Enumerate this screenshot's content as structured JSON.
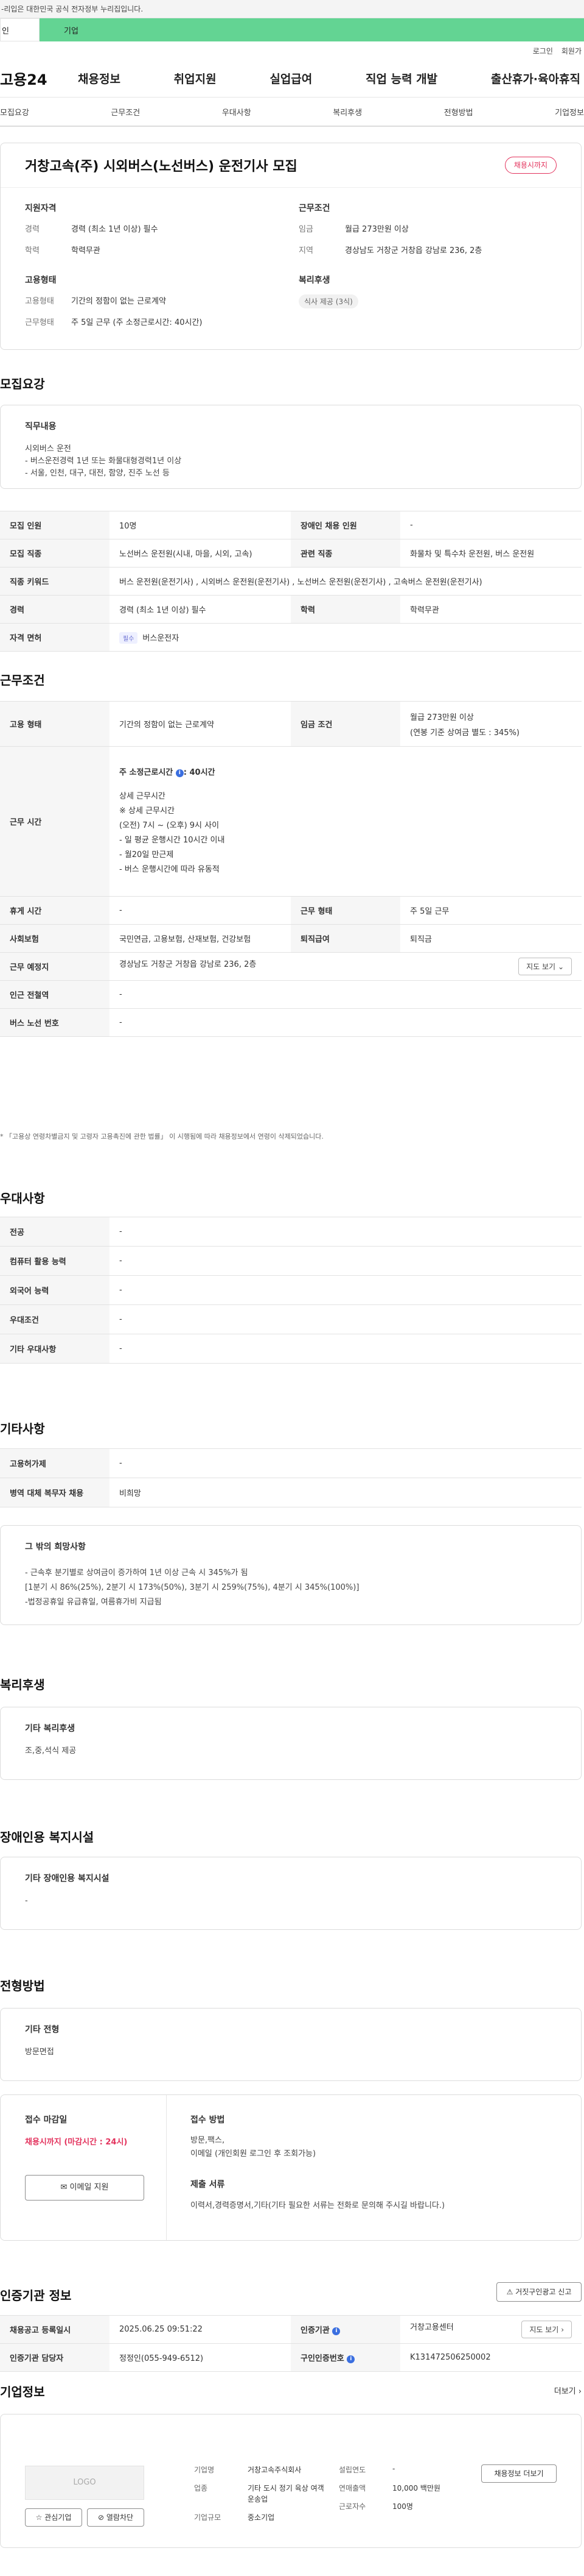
{
  "topbar": {
    "notice": "-리입은 대한민국 공식 전자정부 누리집입니다."
  },
  "target_tabs": {
    "personal": "인",
    "company": "기업"
  },
  "util_links": [
    "로그인",
    "회원가"
  ],
  "gnb": {
    "logo": "고용24",
    "menu": [
      "채용정보",
      "취업지원",
      "실업급여",
      "직업 능력 개발",
      "출산휴가·육아휴직"
    ]
  },
  "anchor_tabs": [
    "모집요강",
    "근무조건",
    "우대사항",
    "복리후생",
    "전형방법",
    "기업정보"
  ],
  "job": {
    "title": "거창고속(주) 시외버스(노선버스) 운전기사 모집",
    "status_pill": "채용시까지",
    "qualification": {
      "heading": "지원자격",
      "rows": [
        {
          "k": "경력",
          "v": "경력 (최소 1년 이상) 필수"
        },
        {
          "k": "학력",
          "v": "학력무관"
        }
      ]
    },
    "conditions": {
      "heading": "근무조건",
      "rows": [
        {
          "k": "임금",
          "v": "월급 273만원 이상"
        },
        {
          "k": "지역",
          "v": "경상남도 거창군 거창읍 강남로 236, 2층"
        }
      ]
    },
    "employment": {
      "heading": "고용형태",
      "rows": [
        {
          "k": "고용형태",
          "v": "기간의 정함이 없는 근로계약"
        },
        {
          "k": "근무형태",
          "v": "주 5일 근무 (주 소정근로시간: 40시간)"
        }
      ]
    },
    "welfare": {
      "heading": "복리후생",
      "chip": "식사 제공 (3식)"
    }
  },
  "recruit": {
    "section_title": "모집요강",
    "duty_heading": "직무내용",
    "duty_text": "시외버스 운전\n- 버스운전경력 1년 또는 화물대형경력1년 이상\n- 서울, 인천, 대구, 대전, 함양, 진주 노선 등",
    "rows": [
      {
        "k1": "모집 인원",
        "v1": "10명",
        "k2": "장애인 채용 인원",
        "v2": "-"
      },
      {
        "k1": "모집 직종",
        "v1": "노선버스 운전원(시내, 마을, 시외, 고속)",
        "k2": "관련 직종",
        "v2": "화물차 및 특수차 운전원, 버스 운전원"
      },
      {
        "k": "직종 키워드",
        "v": "버스 운전원(운전기사) , 시외버스 운전원(운전기사) , 노선버스 운전원(운전기사) , 고속버스 운전원(운전기사)"
      },
      {
        "k1": "경력",
        "v1": "경력 (최소 1년 이상) 필수",
        "k2": "학력",
        "v2": "학력무관"
      },
      {
        "k": "자격 면허",
        "badge": "필수",
        "v": "버스운전자"
      }
    ]
  },
  "work": {
    "section_title": "근무조건",
    "employment_k": "고용 형태",
    "employment_v": "기간의 정함이 없는 근로계약",
    "wage_k": "임금 조건",
    "wage_v1": "월급 273만원 이상",
    "wage_v2": "(연봉 기준 상여금 별도 : 345%)",
    "hours_k": "근무 시간",
    "hours_main": "주 소정근로시간",
    "hours_main_val": ": 40시간",
    "hours_detail": "상세 근무시간\n※ 상세 근무시간\n(오전) 7시 ~ (오후) 9시 사이\n- 일 평균 운행시간 10시간 이내\n- 월20일 만근제\n- 버스 운행시간에 따라 유동적",
    "rows2": [
      {
        "k1": "휴게 시간",
        "v1": "-",
        "k2": "근무 형태",
        "v2": "주 5일 근무"
      },
      {
        "k1": "사회보험",
        "v1": "국민연금, 고용보험, 산재보험, 건강보험",
        "k2": "퇴직급여",
        "v2": "퇴직금"
      }
    ],
    "place_k": "근무 예정지",
    "place_v": "경상남도 거창군 거창읍 강남로 236, 2층",
    "map_btn": "지도 보기",
    "station_k": "인근 전철역",
    "station_v": "-",
    "bus_k": "버스 노선 번호",
    "bus_v": "-",
    "note": "* 「고용상 연령차별금지 및 고령자 고용촉진에 관한 법률」 이 시행됨에 따라 채용정보에서 연령이 삭제되었습니다."
  },
  "preference": {
    "section_title": "우대사항",
    "rows": [
      {
        "k": "전공",
        "v": "-"
      },
      {
        "k": "컴퓨터 활용 능력",
        "v": "-"
      },
      {
        "k": "외국어 능력",
        "v": "-"
      },
      {
        "k": "우대조건",
        "v": "-"
      },
      {
        "k": "기타 우대사항",
        "v": "-"
      }
    ]
  },
  "etc": {
    "section_title": "기타사항",
    "rows": [
      {
        "k": "고용허가제",
        "v": "-"
      },
      {
        "k": "병역 대체 복무자 채용",
        "v": "비희망"
      }
    ],
    "hope_heading": "그 밖의 희망사항",
    "hope_text": "- 근속후 분기별로 상여금이 증가하여 1년 이상 근속 시 345%가 됨\n[1분기 시 86%(25%), 2분기 시 173%(50%), 3분기 시 259%(75%), 4분기 시 345%(100%)]\n-법정공휴일 유급휴일, 여름휴가비 지급됨"
  },
  "welfare": {
    "section_title": "복리후생",
    "heading": "기타 복리후생",
    "text": "조,중,석식 제공"
  },
  "disabled": {
    "section_title": "장애인용 복지시설",
    "heading": "기타 장애인용 복지시설",
    "text": "-"
  },
  "selection": {
    "section_title": "전형방법",
    "heading": "기타 전형",
    "text": "방문면접",
    "deadline_heading": "접수 마감일",
    "deadline_value": "채용시까지 (마감시간 : 24시)",
    "email_btn": "이메일 지원",
    "method_heading": "접수 방법",
    "method_text": "방문,팩스,\n이메일 (개인회원 로그인 후 조회가능)",
    "docs_heading": "제출 서류",
    "docs_text": "이력서,경력증명서,기타(기타 필요한 서류는 전화로 문의해 주시길 바랍니다.)"
  },
  "agency": {
    "section_title": "인증기관 정보",
    "report_btn": "거짓구인광고 신고",
    "rows": [
      {
        "k1": "채용공고 등록일시",
        "v1": "2025.06.25 09:51:22",
        "k2": "인증기관",
        "v2": "거창고용센터",
        "btn": "지도 보기"
      },
      {
        "k1": "인증기관 담당자",
        "v1": "정정인(055-949-6512)",
        "k2": "구인인증번호",
        "v2": "K131472506250002"
      }
    ]
  },
  "company": {
    "section_title": "기업정보",
    "more": "더보기",
    "logo_text": "LOGO",
    "interest_btn": "관심기업",
    "block_btn": "열람차단",
    "jobs_btn": "채용정보 더보기",
    "fields": [
      {
        "k": "기업명",
        "v": "거창고속주식회사"
      },
      {
        "k": "업종",
        "v": "기타 도시 정기 육상 여객 운송업"
      },
      {
        "k": "기업규모",
        "v": "중소기업"
      },
      {
        "k": "설립연도",
        "v": "-"
      },
      {
        "k": "연매출액",
        "v": "10,000 백만원"
      },
      {
        "k": "근로자수",
        "v": "100명"
      }
    ]
  },
  "colors": {
    "brand_green": "#63d493",
    "alert_red": "#e3335d",
    "info_blue": "#3b6fe0"
  }
}
